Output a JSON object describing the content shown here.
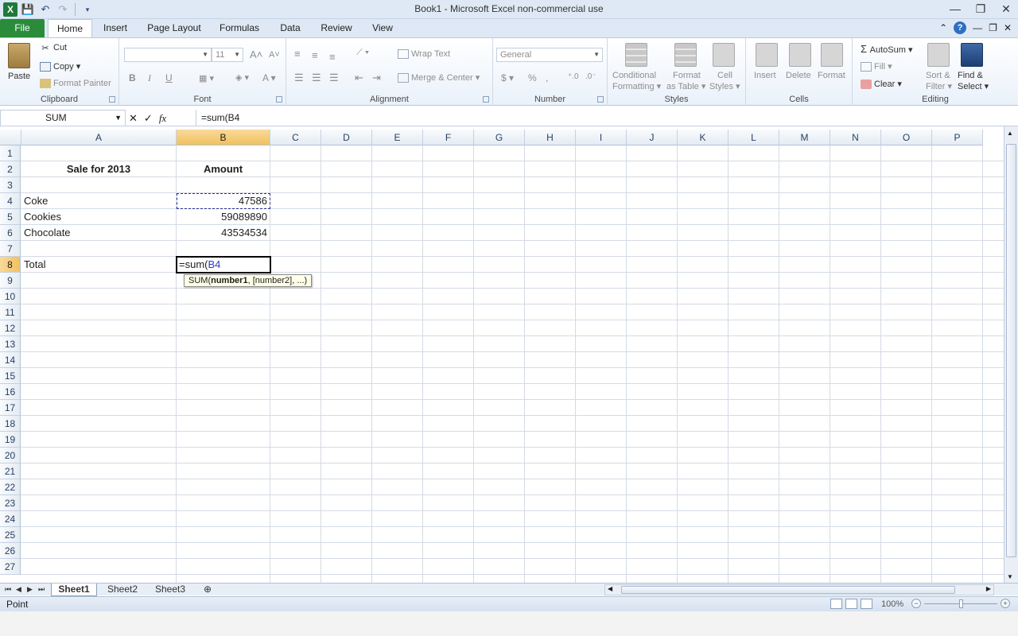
{
  "titlebar": {
    "title": "Book1  -  Microsoft Excel non-commercial use",
    "logo_letter": "X",
    "icons": [
      "excel-logo",
      "save-icon",
      "undo-icon",
      "redo-icon",
      "customize-qat-icon"
    ],
    "controls": {
      "minimize": "—",
      "restore": "❐",
      "close": "✕"
    }
  },
  "tabs": [
    {
      "label": "File"
    },
    {
      "label": "Home"
    },
    {
      "label": "Insert"
    },
    {
      "label": "Page Layout"
    },
    {
      "label": "Formulas"
    },
    {
      "label": "Data"
    },
    {
      "label": "Review"
    },
    {
      "label": "View"
    }
  ],
  "tabs_right": {
    "collapse": "⌃",
    "help": "?",
    "minimize": "—",
    "restore": "❐",
    "close": "✕"
  },
  "ribbon": {
    "clipboard": {
      "label": "Clipboard",
      "paste": "Paste",
      "cut": "Cut",
      "copy": "Copy",
      "format_painter": "Format Painter"
    },
    "font": {
      "label": "Font",
      "size": "11",
      "bold": "B",
      "italic": "I",
      "underline": "U"
    },
    "alignment": {
      "label": "Alignment",
      "wrap_text": "Wrap Text",
      "merge_center": "Merge & Center"
    },
    "number": {
      "label": "Number",
      "format": "General",
      "currency": "$",
      "percent": "%",
      "comma": ","
    },
    "styles": {
      "label": "Styles",
      "conditional_1": "Conditional",
      "conditional_2": "Formatting",
      "format_table_1": "Format",
      "format_table_2": "as Table",
      "cell_styles_1": "Cell",
      "cell_styles_2": "Styles"
    },
    "cells": {
      "label": "Cells",
      "insert": "Insert",
      "delete": "Delete",
      "format": "Format"
    },
    "editing": {
      "label": "Editing",
      "autosum": "AutoSum",
      "fill": "Fill",
      "clear": "Clear",
      "sort_1": "Sort &",
      "sort_2": "Filter",
      "find_1": "Find &",
      "find_2": "Select"
    }
  },
  "formula_bar": {
    "name_box": "SUM",
    "cancel": "✕",
    "enter": "✓",
    "fx": "fx",
    "formula": "=sum(B4"
  },
  "columns": [
    "A",
    "B",
    "C",
    "D",
    "E",
    "F",
    "G",
    "H",
    "I",
    "J",
    "K",
    "L",
    "M",
    "N",
    "O",
    "P"
  ],
  "rows": [
    "1",
    "2",
    "3",
    "4",
    "5",
    "6",
    "7",
    "8",
    "9",
    "10",
    "11",
    "12",
    "13",
    "14",
    "15",
    "16",
    "17",
    "18",
    "19",
    "20",
    "21",
    "22",
    "23",
    "24",
    "25",
    "26",
    "27"
  ],
  "cells": {
    "A2": "Sale for 2013",
    "B2": "Amount",
    "A4": "Coke",
    "B4": "47586",
    "A5": "Cookies",
    "B5": "59089890",
    "A6": "Chocolate",
    "B6": "43534534",
    "A8": "Total",
    "B8_prefix": "=sum(",
    "B8_ref": "B4"
  },
  "tooltip": {
    "fn": "SUM(",
    "arg1": "number1",
    "rest": ", [number2], ...)"
  },
  "sheets": [
    {
      "label": "Sheet1"
    },
    {
      "label": "Sheet2"
    },
    {
      "label": "Sheet3"
    }
  ],
  "status": {
    "mode": "Point",
    "zoom": "100%"
  },
  "colors": {
    "selected_header": "#f1c15f",
    "ref_blue": "#2a3cc7",
    "file_tab": "#2a8c3a"
  }
}
